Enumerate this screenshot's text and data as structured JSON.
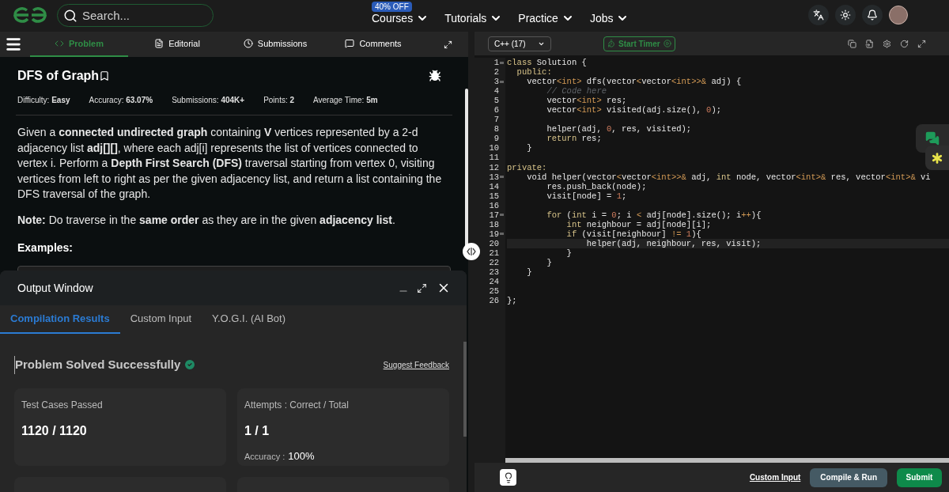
{
  "nav": {
    "search_placeholder": "Search...",
    "items": [
      {
        "label": "Courses",
        "badge": "40% OFF"
      },
      {
        "label": "Tutorials"
      },
      {
        "label": "Practice"
      },
      {
        "label": "Jobs"
      }
    ]
  },
  "problem_tabs": [
    {
      "label": "Problem",
      "selected": true
    },
    {
      "label": "Editorial",
      "selected": false
    },
    {
      "label": "Submissions",
      "selected": false
    },
    {
      "label": "Comments",
      "selected": false
    }
  ],
  "problem": {
    "title": "DFS of Graph",
    "stats": [
      "Difficulty: **Easy**",
      "Accuracy: **63.07%**",
      "Submissions: **404K+**",
      "Points: **2**",
      "Average Time: **5m**"
    ],
    "description": "Given a **connected undirected graph** containing **V** vertices represented by a 2-d adjacency list **adj[][]**, where each adj[i] represents the list of vertices connected to vertex i. Perform a **Depth First Search (DFS)** traversal starting from vertex 0, visiting vertices from left to right as per the given adjacency list, and return a list containing the DFS traversal of the graph.",
    "note": "**Note:** Do traverse in the **same order** as they are in the given **adjacency list**.",
    "examples_heading": "Examples:"
  },
  "output_window": {
    "title": "Output Window",
    "tabs": [
      {
        "label": "Compilation Results",
        "selected": true
      },
      {
        "label": "Custom Input",
        "selected": false
      },
      {
        "label": "Y.O.G.I. (AI Bot)",
        "selected": false
      }
    ],
    "status": "Problem Solved Successfully",
    "feedback_link": "Suggest Feedback",
    "cards": [
      {
        "label": "Test Cases Passed",
        "value": "1120 / 1120"
      },
      {
        "label": "Attempts : Correct / Total",
        "value": "1 / 1",
        "sub_label": "Accuracy :",
        "sub_value": "100%"
      }
    ]
  },
  "editor": {
    "language": "C++ (17)",
    "timer_button": "Start Timer",
    "custom_input_link": "Custom Input",
    "compile_button": "Compile & Run",
    "submit_button": "Submit",
    "lines": [
      {
        "no": "1",
        "fold": true,
        "current": false,
        "tokens": [
          {
            "text": "class",
            "kind": "keyword"
          },
          {
            "text": " Solution {",
            "kind": "plain"
          }
        ]
      },
      {
        "no": "2",
        "fold": false,
        "current": false,
        "tokens": [
          {
            "text": "  public:",
            "kind": "keyword"
          }
        ]
      },
      {
        "no": "3",
        "fold": true,
        "current": false,
        "tokens": [
          {
            "text": "    vector",
            "kind": "plain"
          },
          {
            "text": "<int>",
            "kind": "operator"
          },
          {
            "text": " dfs(vector",
            "kind": "plain"
          },
          {
            "text": "<",
            "kind": "operator"
          },
          {
            "text": "vector",
            "kind": "plain"
          },
          {
            "text": "<int>>&",
            "kind": "operator"
          },
          {
            "text": " adj) {",
            "kind": "plain"
          }
        ]
      },
      {
        "no": "4",
        "fold": false,
        "current": false,
        "tokens": [
          {
            "text": "        // Code here",
            "kind": "comment"
          }
        ]
      },
      {
        "no": "5",
        "fold": false,
        "current": false,
        "tokens": [
          {
            "text": "        vector",
            "kind": "plain"
          },
          {
            "text": "<int>",
            "kind": "operator"
          },
          {
            "text": " res;",
            "kind": "plain"
          }
        ]
      },
      {
        "no": "6",
        "fold": false,
        "current": false,
        "tokens": [
          {
            "text": "        vector",
            "kind": "plain"
          },
          {
            "text": "<int>",
            "kind": "operator"
          },
          {
            "text": " visited(adj.size(), ",
            "kind": "plain"
          },
          {
            "text": "0",
            "kind": "number"
          },
          {
            "text": ");",
            "kind": "plain"
          }
        ]
      },
      {
        "no": "7",
        "fold": false,
        "current": false
      },
      {
        "no": "8",
        "fold": false,
        "current": false,
        "tokens": [
          {
            "text": "        helper(adj, ",
            "kind": "plain"
          },
          {
            "text": "0",
            "kind": "number"
          },
          {
            "text": ", res, visited);",
            "kind": "plain"
          }
        ]
      },
      {
        "no": "9",
        "fold": false,
        "current": false,
        "tokens": [
          {
            "text": "        return",
            "kind": "keyword"
          },
          {
            "text": " res;",
            "kind": "plain"
          }
        ]
      },
      {
        "no": "10",
        "fold": false,
        "current": false,
        "tokens": [
          {
            "text": "    }",
            "kind": "plain"
          }
        ]
      },
      {
        "no": "11",
        "fold": false,
        "current": false
      },
      {
        "no": "12",
        "fold": false,
        "current": false,
        "tokens": [
          {
            "text": "private:",
            "kind": "keyword"
          }
        ]
      },
      {
        "no": "13",
        "fold": true,
        "current": false,
        "tokens": [
          {
            "text": "    void helper(vector",
            "kind": "plain"
          },
          {
            "text": "<",
            "kind": "operator"
          },
          {
            "text": "vector",
            "kind": "plain"
          },
          {
            "text": "<int>>&",
            "kind": "operator"
          },
          {
            "text": " adj, ",
            "kind": "plain"
          },
          {
            "text": "int",
            "kind": "keyword"
          },
          {
            "text": " node, vector",
            "kind": "plain"
          },
          {
            "text": "<int>&",
            "kind": "operator"
          },
          {
            "text": " res, vector",
            "kind": "plain"
          },
          {
            "text": "<int>&",
            "kind": "operator"
          },
          {
            "text": " vi",
            "kind": "plain"
          }
        ]
      },
      {
        "no": "14",
        "fold": false,
        "current": false,
        "tokens": [
          {
            "text": "        res.push_back(node);",
            "kind": "plain"
          }
        ]
      },
      {
        "no": "15",
        "fold": false,
        "current": false,
        "tokens": [
          {
            "text": "        visit[node] = ",
            "kind": "plain"
          },
          {
            "text": "1",
            "kind": "number"
          },
          {
            "text": ";",
            "kind": "plain"
          }
        ]
      },
      {
        "no": "16",
        "fold": false,
        "current": false
      },
      {
        "no": "17",
        "fold": true,
        "current": false,
        "tokens": [
          {
            "text": "        for",
            "kind": "keyword"
          },
          {
            "text": " (",
            "kind": "plain"
          },
          {
            "text": "int",
            "kind": "keyword"
          },
          {
            "text": " i = ",
            "kind": "plain"
          },
          {
            "text": "0",
            "kind": "number"
          },
          {
            "text": "; i ",
            "kind": "plain"
          },
          {
            "text": "<",
            "kind": "operator"
          },
          {
            "text": " adj[node].size(); i",
            "kind": "plain"
          },
          {
            "text": "++",
            "kind": "operator"
          },
          {
            "text": "){",
            "kind": "plain"
          }
        ]
      },
      {
        "no": "18",
        "fold": false,
        "current": false,
        "tokens": [
          {
            "text": "            int",
            "kind": "keyword"
          },
          {
            "text": " neighbour = adj[node][i];",
            "kind": "plain"
          }
        ]
      },
      {
        "no": "19",
        "fold": true,
        "current": false,
        "tokens": [
          {
            "text": "            if",
            "kind": "keyword"
          },
          {
            "text": " (visit[neighbour] ",
            "kind": "plain"
          },
          {
            "text": "!= ",
            "kind": "operator"
          },
          {
            "text": "1",
            "kind": "number"
          },
          {
            "text": "){",
            "kind": "plain"
          }
        ]
      },
      {
        "no": "20",
        "fold": false,
        "current": true,
        "tokens": [
          {
            "text": "                helper(adj, neighbour, res, visit);",
            "kind": "plain"
          }
        ]
      },
      {
        "no": "21",
        "fold": false,
        "current": false,
        "tokens": [
          {
            "text": "            }",
            "kind": "plain"
          }
        ]
      },
      {
        "no": "22",
        "fold": false,
        "current": false,
        "tokens": [
          {
            "text": "        }",
            "kind": "plain"
          }
        ]
      },
      {
        "no": "23",
        "fold": false,
        "current": false,
        "tokens": [
          {
            "text": "    }",
            "kind": "plain"
          }
        ]
      },
      {
        "no": "24",
        "fold": false,
        "current": false
      },
      {
        "no": "25",
        "fold": false,
        "current": false
      },
      {
        "no": "26",
        "fold": false,
        "current": false,
        "tokens": [
          {
            "text": "};",
            "kind": "plain"
          }
        ]
      }
    ]
  }
}
